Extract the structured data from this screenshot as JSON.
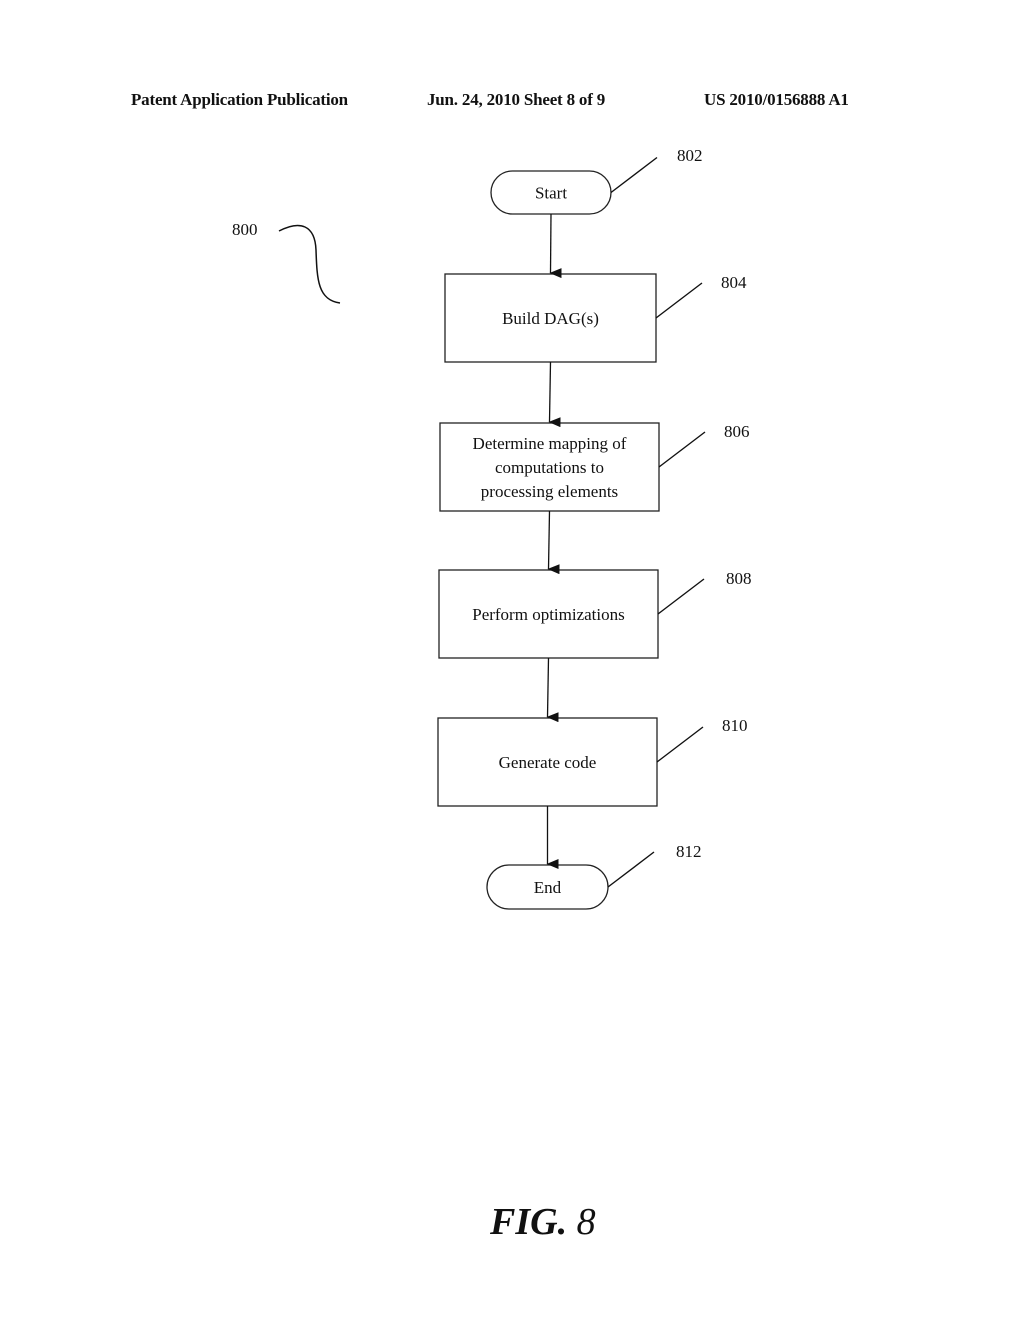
{
  "header": {
    "publication": "Patent Application Publication",
    "date_sheet": "Jun. 24, 2010  Sheet 8 of 9",
    "number": "US 2010/0156888 A1"
  },
  "figure": {
    "label_prefix": "FIG.",
    "label_number": "8",
    "ref": "800"
  },
  "flowchart": {
    "nodes": [
      {
        "id": "802",
        "type": "terminal",
        "lines": [
          "Start"
        ]
      },
      {
        "id": "804",
        "type": "process",
        "lines": [
          "Build DAG(s)"
        ]
      },
      {
        "id": "806",
        "type": "process",
        "lines": [
          "Determine mapping of",
          "computations to",
          "processing elements"
        ]
      },
      {
        "id": "808",
        "type": "process",
        "lines": [
          "Perform optimizations"
        ]
      },
      {
        "id": "810",
        "type": "process",
        "lines": [
          "Generate code"
        ]
      },
      {
        "id": "812",
        "type": "terminal",
        "lines": [
          "End"
        ]
      }
    ],
    "edges": [
      [
        "802",
        "804"
      ],
      [
        "804",
        "806"
      ],
      [
        "806",
        "808"
      ],
      [
        "808",
        "810"
      ],
      [
        "810",
        "812"
      ]
    ]
  }
}
